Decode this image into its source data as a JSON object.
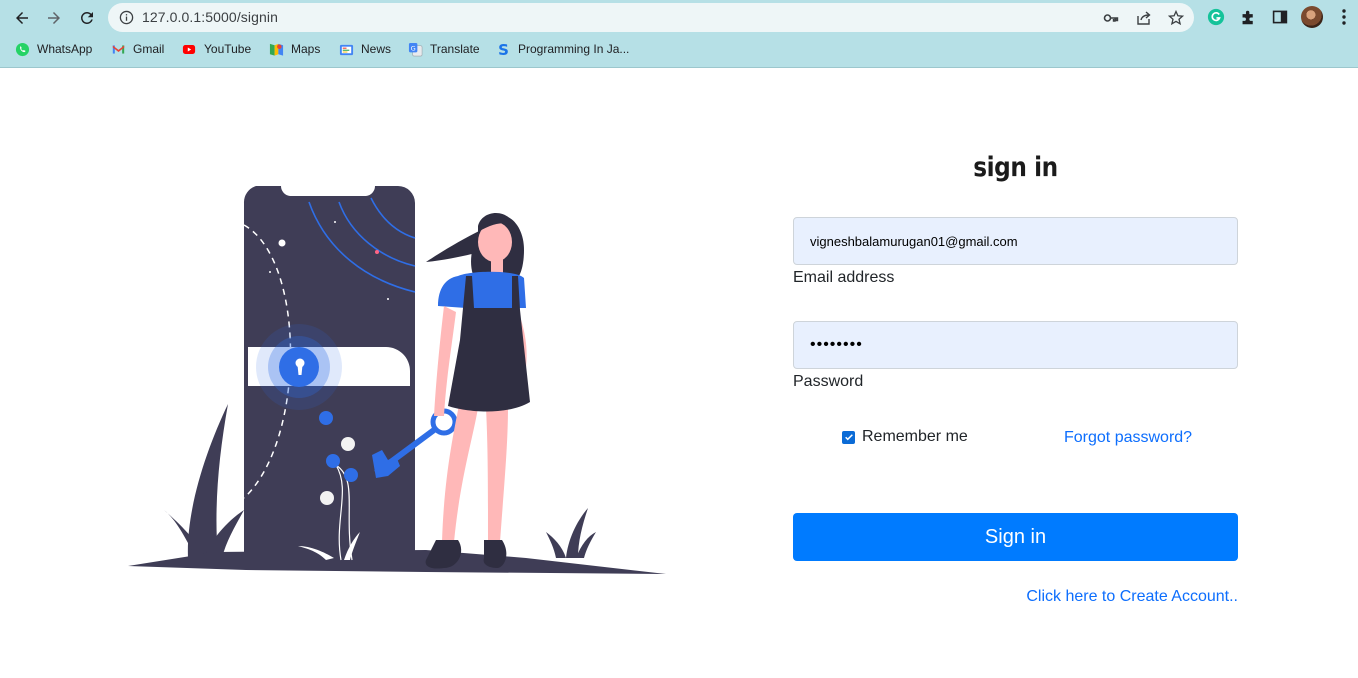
{
  "browser": {
    "url": "127.0.0.1:5000/signin",
    "bookmarks": [
      {
        "label": "WhatsApp",
        "icon": "whatsapp-icon"
      },
      {
        "label": "Gmail",
        "icon": "gmail-icon"
      },
      {
        "label": "YouTube",
        "icon": "youtube-icon"
      },
      {
        "label": "Maps",
        "icon": "maps-icon"
      },
      {
        "label": "News",
        "icon": "news-icon"
      },
      {
        "label": "Translate",
        "icon": "translate-icon"
      },
      {
        "label": "Programming In Ja...",
        "icon": "programming-s-icon"
      }
    ],
    "accent": "#b6e0e6"
  },
  "signin": {
    "title": "sign in",
    "email_value": "vigneshbalamurugan01@gmail.com",
    "email_label": "Email address",
    "password_value": "••••••••",
    "password_label": "Password",
    "remember_label": "Remember me",
    "remember_checked": true,
    "forgot_label": "Forgot password?",
    "submit_label": "Sign in",
    "create_account_label": "Click here to Create Account..",
    "button_color": "#007bff",
    "link_color": "#0d6efd",
    "field_bg": "#e8f0fe"
  }
}
